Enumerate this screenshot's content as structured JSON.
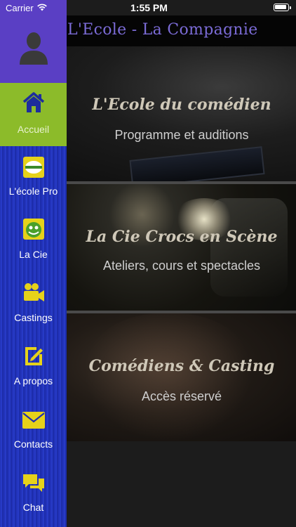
{
  "status": {
    "carrier": "Carrier",
    "time": "1:55 PM"
  },
  "app": {
    "title": "L'Ecole - La Compagnie"
  },
  "cards": [
    {
      "title": "L'Ecole du comédien",
      "subtitle": "Programme et auditions"
    },
    {
      "title": "La Cie Crocs en Scène",
      "subtitle": "Ateliers, cours et spectacles"
    },
    {
      "title": "Comédiens & Casting",
      "subtitle": "Accès réservé"
    }
  ],
  "menu": {
    "items": [
      {
        "label": "Accueil",
        "icon": "home-icon",
        "active": true
      },
      {
        "label": "L'école Pro",
        "icon": "ecole-pro-logo-icon",
        "active": false
      },
      {
        "label": "La Cie",
        "icon": "la-cie-logo-icon",
        "active": false
      },
      {
        "label": "Castings",
        "icon": "video-camera-icon",
        "active": false
      },
      {
        "label": "A propos",
        "icon": "edit-square-icon",
        "active": false
      },
      {
        "label": "Contacts",
        "icon": "envelope-icon",
        "active": false
      },
      {
        "label": "Chat",
        "icon": "chat-bubbles-icon",
        "active": false
      }
    ]
  },
  "colors": {
    "drawer_blue": "#2436c4",
    "profile_purple": "#5a3fc4",
    "active_green": "#8cbb2a",
    "icon_yellow": "#e6d21a",
    "title_purple": "#7b6bd6"
  }
}
